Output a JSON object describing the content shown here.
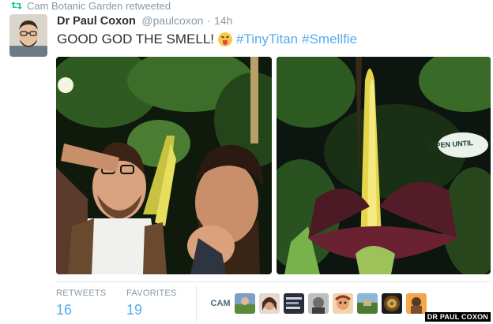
{
  "retweet": {
    "text": "Cam Botanic Garden retweeted"
  },
  "tweet": {
    "display_name": "Dr Paul Coxon",
    "handle": "@paulcoxon",
    "separator": "·",
    "time": "14h",
    "text": "GOOD GOD THE SMELL!",
    "emoji": "squinting-face-with-tongue",
    "hashtags": [
      "#TinyTitan",
      "#Smellfie"
    ],
    "photo_sign_text": "OPEN UNTIL"
  },
  "stats": {
    "retweets_label": "RETWEETS",
    "retweets_value": "16",
    "favorites_label": "FAVORITES",
    "favorites_value": "19"
  },
  "favoriters": {
    "first_logo_text": "CAM"
  },
  "colors": {
    "link": "#55acee",
    "muted": "#8899a6",
    "retweet_green": "#19cf86",
    "text": "#292f33"
  },
  "watermark": {
    "text": "DR PAUL COXON"
  }
}
